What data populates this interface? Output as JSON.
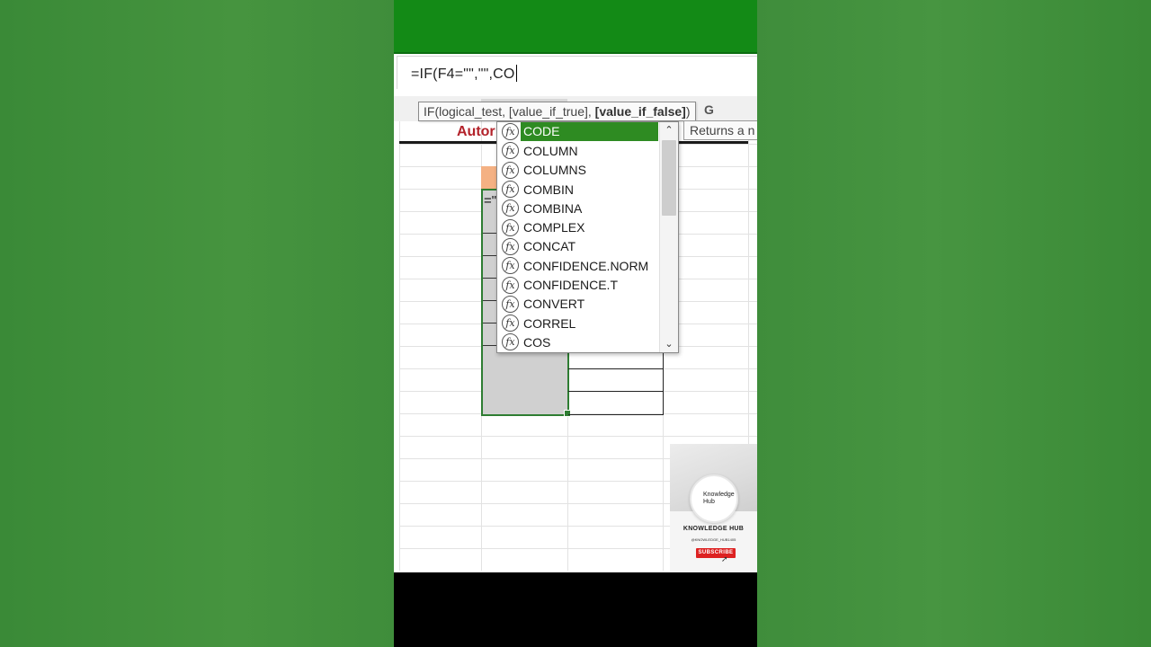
{
  "formula_bar": {
    "value": "=IF(F4=\"\",\"\",CO"
  },
  "tooltip": {
    "prefix": "IF(logical_test, [value_if_true], ",
    "bold_arg": "[value_if_false]",
    "suffix": ")",
    "ghost_char": "G"
  },
  "description_tip": {
    "text": "Returns a n"
  },
  "sheet": {
    "title_partial": "Autor",
    "active_cell_text": "=\""
  },
  "autocomplete": {
    "items": [
      "CODE",
      "COLUMN",
      "COLUMNS",
      "COMBIN",
      "COMBINA",
      "COMPLEX",
      "CONCAT",
      "CONFIDENCE.NORM",
      "CONFIDENCE.T",
      "CONVERT",
      "CORREL",
      "COS"
    ],
    "selected_index": 0,
    "icon": "fx-function-icon",
    "scroll_up": "⌃",
    "scroll_down": "⌄"
  },
  "promo": {
    "logo_text": "Knowledge Hub",
    "name": "KNOWLEDGE HUB",
    "handle": "@KNOWLEDGE_HUB1405",
    "subscribe": "SUBSCRIBE"
  },
  "colors": {
    "title_band": "#138a16",
    "selected_item": "#2e8b22",
    "sheet_title": "#b3222a",
    "peach_cell": "#f4b183",
    "selection_border": "#2e7d32",
    "subscribe": "#dd2222"
  }
}
